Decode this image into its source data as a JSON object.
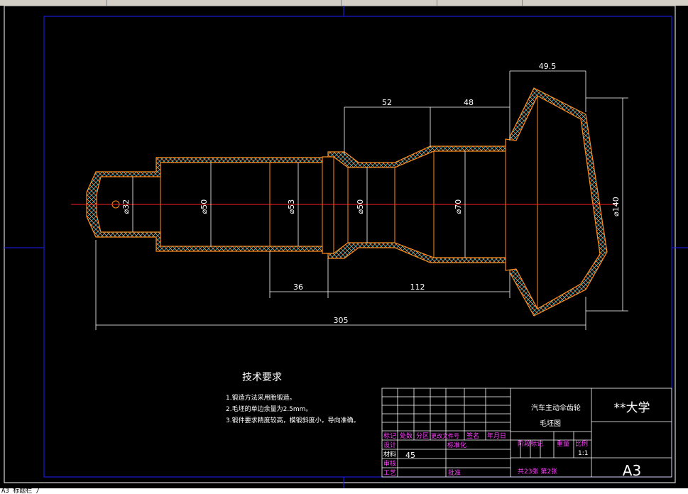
{
  "dimensions": {
    "d_hole": "⌀32",
    "d_neck": "⌀50",
    "d_journal": "⌀53",
    "d_groove": "⌀50",
    "d_body": "⌀70",
    "d_head": "⌀140",
    "len_52": "52",
    "len_48": "48",
    "len_49_5": "49.5",
    "len_36": "36",
    "len_112": "112",
    "len_305": "305"
  },
  "notes": {
    "title": "技术要求",
    "items": [
      "1.锻造方法采用胎锻造。",
      "2.毛坯的单边余量为2.5mm。",
      "3.锻件要求精度较高，模锻斜度小，导向准确。"
    ]
  },
  "title_block": {
    "part_name_line1": "汽车主动伞齿轮",
    "part_name_line2": "毛坯图",
    "org": "**大学",
    "sheet_size": "A3",
    "header_labels": [
      "标记",
      "处数",
      "分区",
      "更改文件号",
      "签名",
      "年月日"
    ],
    "design": "设计",
    "standardize": "标准化",
    "material_label": "材料",
    "material_value": "45",
    "check": "审核",
    "process": "工艺",
    "approve": "批准",
    "stage_mark": "阶段标记",
    "weight": "重量",
    "scale": "比例",
    "scale_value": "1:1",
    "sheets": "共23张 第2张"
  },
  "command_line": "A3 标题栏 /"
}
